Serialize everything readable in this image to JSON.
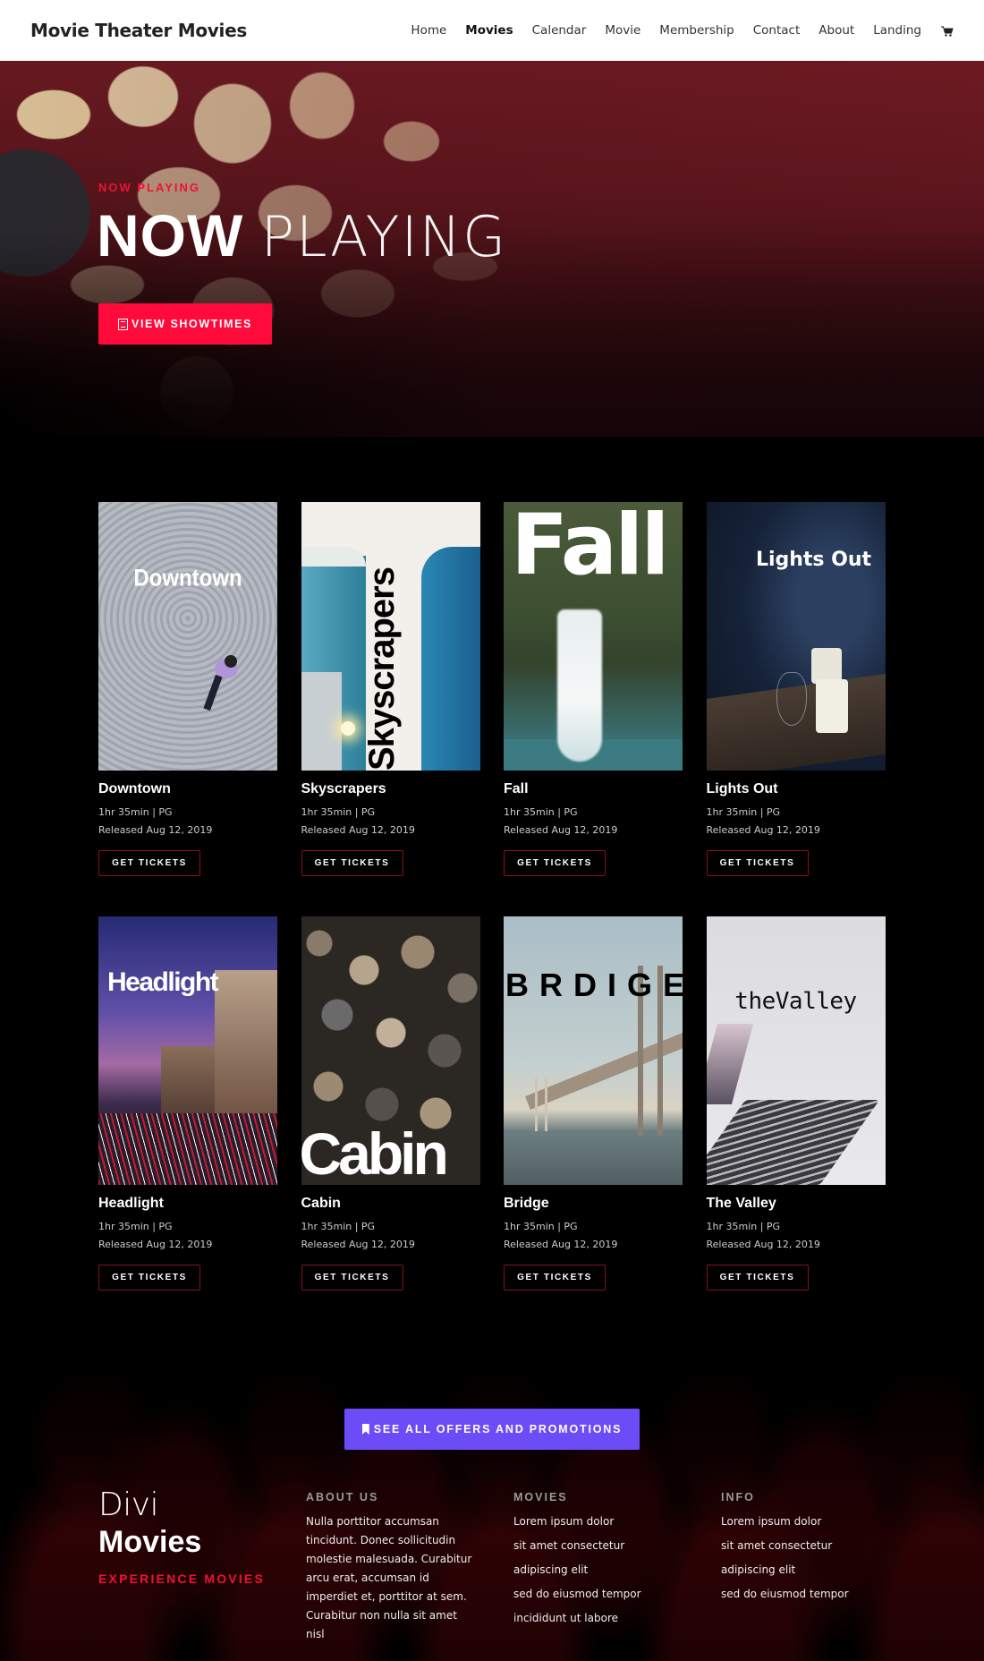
{
  "header": {
    "logo": "Movie Theater Movies",
    "nav": [
      {
        "label": "Home",
        "active": false
      },
      {
        "label": "Movies",
        "active": true
      },
      {
        "label": "Calendar",
        "active": false
      },
      {
        "label": "Movie",
        "active": false
      },
      {
        "label": "Membership",
        "active": false
      },
      {
        "label": "Contact",
        "active": false
      },
      {
        "label": "About",
        "active": false
      },
      {
        "label": "Landing",
        "active": false
      }
    ],
    "cart_icon": "shopping-cart-icon"
  },
  "hero": {
    "eyebrow": "NOW PLAYING",
    "title_bold": "NOW",
    "title_thin": "PLAYING",
    "button_label": "VIEW SHOWTIMES",
    "button_icon": "film-icon",
    "accent_color": "#ff0a3a"
  },
  "movies": [
    {
      "title": "Downtown",
      "poster_text": "Downtown",
      "duration_rating": "1hr 35min | PG",
      "released": "Released Aug 12, 2019",
      "button": "GET TICKETS"
    },
    {
      "title": "Skyscrapers",
      "poster_text": "Skyscrapers",
      "duration_rating": "1hr 35min | PG",
      "released": "Released Aug 12, 2019",
      "button": "GET TICKETS"
    },
    {
      "title": "Fall",
      "poster_text": "Fall",
      "duration_rating": "1hr 35min | PG",
      "released": "Released Aug 12, 2019",
      "button": "GET TICKETS"
    },
    {
      "title": "Lights Out",
      "poster_text": "Lights Out",
      "duration_rating": "1hr 35min | PG",
      "released": "Released Aug 12, 2019",
      "button": "GET TICKETS"
    },
    {
      "title": "Headlight",
      "poster_text": "Headlight",
      "duration_rating": "1hr 35min | PG",
      "released": "Released Aug 12, 2019",
      "button": "GET TICKETS"
    },
    {
      "title": "Cabin",
      "poster_text": "Cabin",
      "duration_rating": "1hr 35min | PG",
      "released": "Released Aug 12, 2019",
      "button": "GET TICKETS"
    },
    {
      "title": "Bridge",
      "poster_text": "BRDIGE",
      "duration_rating": "1hr 35min | PG",
      "released": "Released Aug 12, 2019",
      "button": "GET TICKETS"
    },
    {
      "title": "The Valley",
      "poster_text": "theValley",
      "duration_rating": "1hr 35min | PG",
      "released": "Released Aug 12, 2019",
      "button": "GET TICKETS"
    }
  ],
  "promo": {
    "button_label": "SEE ALL OFFERS AND PROMOTIONS",
    "button_icon": "bookmark-icon",
    "color": "#6b4cf6"
  },
  "footer": {
    "brand_line1": "Divi",
    "brand_line2": "Movies",
    "tagline": "EXPERIENCE MOVIES",
    "about": {
      "heading": "ABOUT US",
      "text": "Nulla porttitor accumsan tincidunt. Donec sollicitudin molestie malesuada. Curabitur arcu erat, accumsan id imperdiet et, porttitor at sem. Curabitur non nulla sit amet nisl"
    },
    "movies": {
      "heading": "MOVIES",
      "links": [
        "Lorem ipsum dolor",
        "sit amet consectetur",
        "adipiscing elit",
        "sed do eiusmod tempor",
        "incididunt ut labore"
      ]
    },
    "info": {
      "heading": "INFO",
      "links": [
        "Lorem ipsum dolor",
        "sit amet consectetur",
        "adipiscing elit",
        "sed do eiusmod tempor"
      ]
    }
  }
}
